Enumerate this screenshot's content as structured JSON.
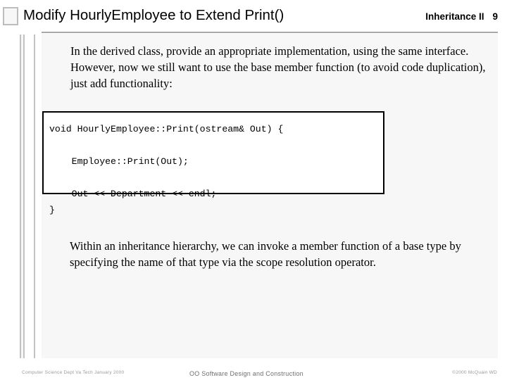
{
  "slide": {
    "title": "Modify HourlyEmployee to Extend Print()",
    "chapter": "Inheritance II",
    "page_number": "9",
    "paragraph_top": "In the derived class, provide an appropriate implementation, using the same interface.  However, now we still want to use the base member function (to avoid code duplication), just add functionality:",
    "code": "void HourlyEmployee::Print(ostream& Out) {\n\n    Employee::Print(Out);\n\n    Out << Department << endl;\n}",
    "paragraph_bottom": "Within an inheritance hierarchy, we can invoke a member function of a base type by specifying the name of that type via the scope resolution operator."
  },
  "footer": {
    "left": "Computer Science Dept Va Tech January 2000",
    "center": "OO Software Design and Construction",
    "right": "©2000  McQuain WD"
  },
  "colors": {
    "page_background": "#ffffff",
    "panel_background": "#f7f7f7",
    "rule": "#a8a8a8",
    "code_border": "#000000",
    "footer_text": "#9a9a9a"
  }
}
